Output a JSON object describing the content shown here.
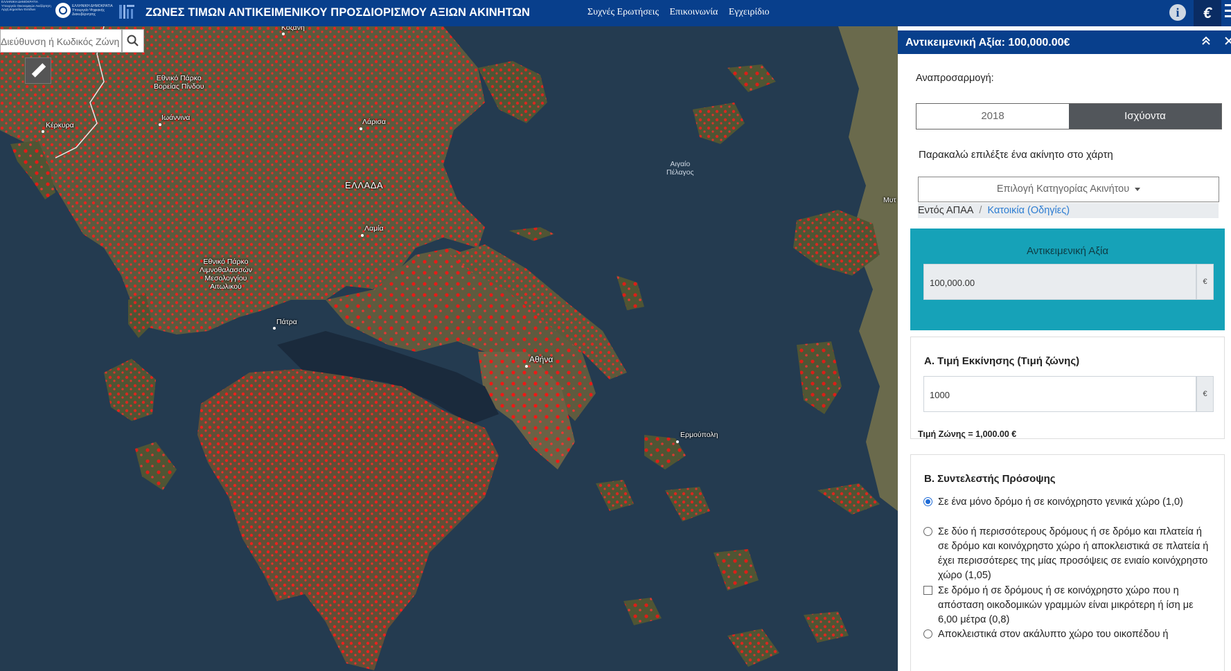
{
  "header": {
    "logo1_text": "ΕΛΛΗΝΙΚΗ ΔΗΜΟΚΡΑΤΙΑ Υπουργείο Οικονομικών Ανεξάρτητη Αρχή Δημοσίων Εσόδων",
    "logo3_text": "ΕΛΛΗΝΙΚΗ ΔΗΜΟΚΡΑΤΙΑ Υπουργείο Ψηφιακής Διακυβέρνησης",
    "title": "ΖΩΝΕΣ ΤΙΜΩΝ ΑΝΤΙΚΕΙΜΕΝΙΚΟΥ ΠΡΟΣΔΙΟΡΙΣΜΟΥ ΑΞΙΩΝ ΑΚΙΝΗΤΩΝ",
    "nav": [
      "Συχνές Ερωτήσεις",
      "Επικοινωνία",
      "Εγχειρίδιο"
    ],
    "info_label": "i",
    "euro_label": "€"
  },
  "map": {
    "search_placeholder": "Διεύθυνση ή Κωδικός Ζώνη",
    "labels": {
      "kozani": "Κοζάνη",
      "pindos": "Εθνικό Πάρκο\nΒορείας Πίνδου",
      "ioannina": "Ιωάννινα",
      "kerkyra": "Κέρκυρα",
      "larisa": "Λάρισα",
      "ellada": "ΕΛΛΑΔΑ",
      "lamia": "Λαμία",
      "mesolonghi": "Εθνικό Πάρκο\nΛιμνοθαλασσών\nΜεσολογγίου\nΑιτωλικού",
      "patra": "Πάτρα",
      "athina": "Αθήνα",
      "ermoupoli": "Ερμούπολη",
      "aigaio": "Αιγαίο\nΠέλαγος",
      "mytilene": "Μυτ"
    }
  },
  "panel": {
    "header_title": "Αντικειμενική Αξία: 100,000.00€",
    "revaluation_label": "Αναπροσαρμογή:",
    "toggle_options": [
      "2018",
      "Ισχύοντα"
    ],
    "select_prompt": "Παρακαλώ επιλέξτε ένα ακίνητο στο χάρτη",
    "category_dropdown": "Επιλογή Κατηγορίας Ακινήτου",
    "breadcrumb": {
      "first": "Εντός ΑΠΑΑ",
      "separator": "/",
      "link": "Κατοικία (Οδηγίες)"
    },
    "objective_value": {
      "title": "Αντικειμενική Αξία",
      "value": "100,000.00",
      "currency": "€"
    },
    "starting_price": {
      "title": "Α. Τιμή Εκκίνησης (Τιμή ζώνης)",
      "value": "1000",
      "currency": "€",
      "zone_price": "Τιμή Ζώνης = 1,000.00 €"
    },
    "facade": {
      "title": "Β. Συντελεστής Πρόσοψης",
      "options": [
        "Σε ένα μόνο δρόμο ή σε κοινόχρηστο γενικά χώρο (1,0)",
        "Σε δύο ή περισσότερους δρόμους ή σε δρόμο και πλατεία ή σε δρόμο και κοινόχρηστο χώρο ή αποκλειστικά σε πλατεία ή έχει περισσότερες της μίας προσόψεις σε ενιαίο κοινόχρηστο χώρο (1,05)",
        "Σε δρόμο ή σε δρόμους ή σε κοινόχρηστο χώρο που η απόσταση οικοδομικών γραμμών είναι μικρότερη ή ίση με 6,00 μέτρα (0,8)",
        "Αποκλειστικά στον ακάλυπτο χώρο του οικοπέδου ή"
      ]
    }
  }
}
